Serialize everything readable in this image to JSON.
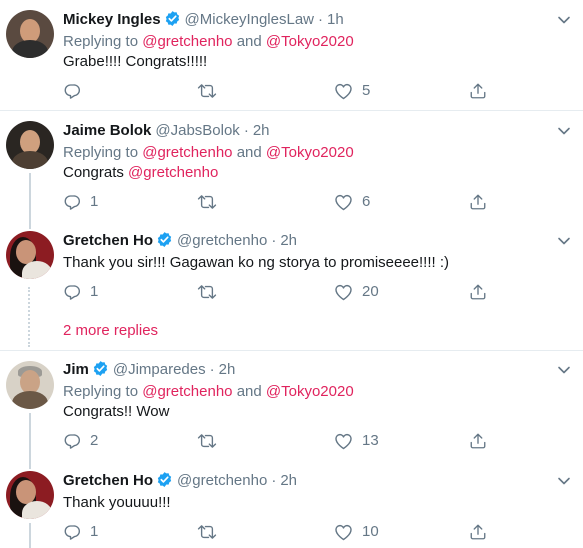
{
  "tweets": [
    {
      "name": "Mickey Ingles",
      "verified": true,
      "handle": "@MickeyInglesLaw",
      "time": "1h",
      "replying_prefix": "Replying to",
      "replying_to": [
        "@gretchenho",
        "@Tokyo2020"
      ],
      "replying_and": "and",
      "text": "Grabe!!!! Congrats!!!!!",
      "replies": "",
      "retweets": "",
      "likes": "5"
    },
    {
      "name": "Jaime Bolok",
      "verified": false,
      "handle": "@JabsBolok",
      "time": "2h",
      "replying_prefix": "Replying to",
      "replying_to": [
        "@gretchenho",
        "@Tokyo2020"
      ],
      "replying_and": "and",
      "text": "Congrats",
      "text_mention": "@gretchenho",
      "replies": "1",
      "retweets": "",
      "likes": "6"
    },
    {
      "name": "Gretchen Ho",
      "verified": true,
      "handle": "@gretchenho",
      "time": "2h",
      "text": "Thank you sir!!! Gagawan ko ng storya to promiseeee!!!! :)",
      "replies": "1",
      "retweets": "",
      "likes": "20"
    },
    {
      "name": "Jim",
      "verified": true,
      "handle": "@Jimparedes",
      "time": "2h",
      "replying_prefix": "Replying to",
      "replying_to": [
        "@gretchenho",
        "@Tokyo2020"
      ],
      "replying_and": "and",
      "text": "Congrats!! Wow",
      "replies": "2",
      "retweets": "",
      "likes": "13"
    },
    {
      "name": "Gretchen Ho",
      "verified": true,
      "handle": "@gretchenho",
      "time": "2h",
      "text": "Thank youuuu!!!",
      "replies": "1",
      "retweets": "",
      "likes": "10"
    }
  ],
  "more_replies": "2 more replies",
  "separator": "·",
  "colors": {
    "mention": "#e0245e",
    "muted": "#657786",
    "verified": "#1da1f2",
    "divider": "#e6ecf0"
  },
  "icons": [
    "reply-icon",
    "retweet-icon",
    "like-icon",
    "share-icon",
    "caret-down-icon",
    "verified-badge-icon"
  ]
}
